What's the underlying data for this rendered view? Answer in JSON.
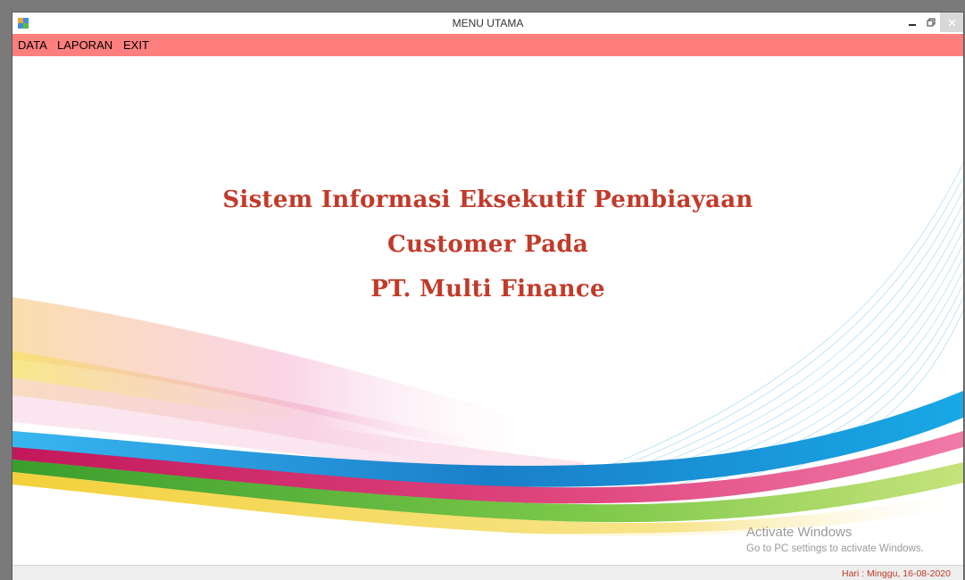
{
  "window": {
    "title": "MENU UTAMA"
  },
  "menu": {
    "items": [
      "DATA",
      "LAPORAN",
      "EXIT"
    ]
  },
  "headline": {
    "line1": "Sistem Informasi Eksekutif Pembiayaan",
    "line2": "Customer Pada",
    "line3": "PT. Multi Finance"
  },
  "watermark": {
    "title": "Activate Windows",
    "subtitle": "Go to PC settings to activate Windows."
  },
  "status": {
    "text": "Hari : Minggu, 16-08-2020"
  },
  "colors": {
    "menubar": "#ff7f7f",
    "headline": "#c23a2a",
    "status_text": "#c0392b",
    "wave_blue": "#1aa3e8",
    "wave_magenta": "#d63a8c",
    "wave_green": "#6cbf3a",
    "wave_yellow": "#f2d44a"
  },
  "icons": {
    "app": "app-icon",
    "minimize": "minimize-icon",
    "restore": "restore-icon",
    "close": "close-icon"
  }
}
